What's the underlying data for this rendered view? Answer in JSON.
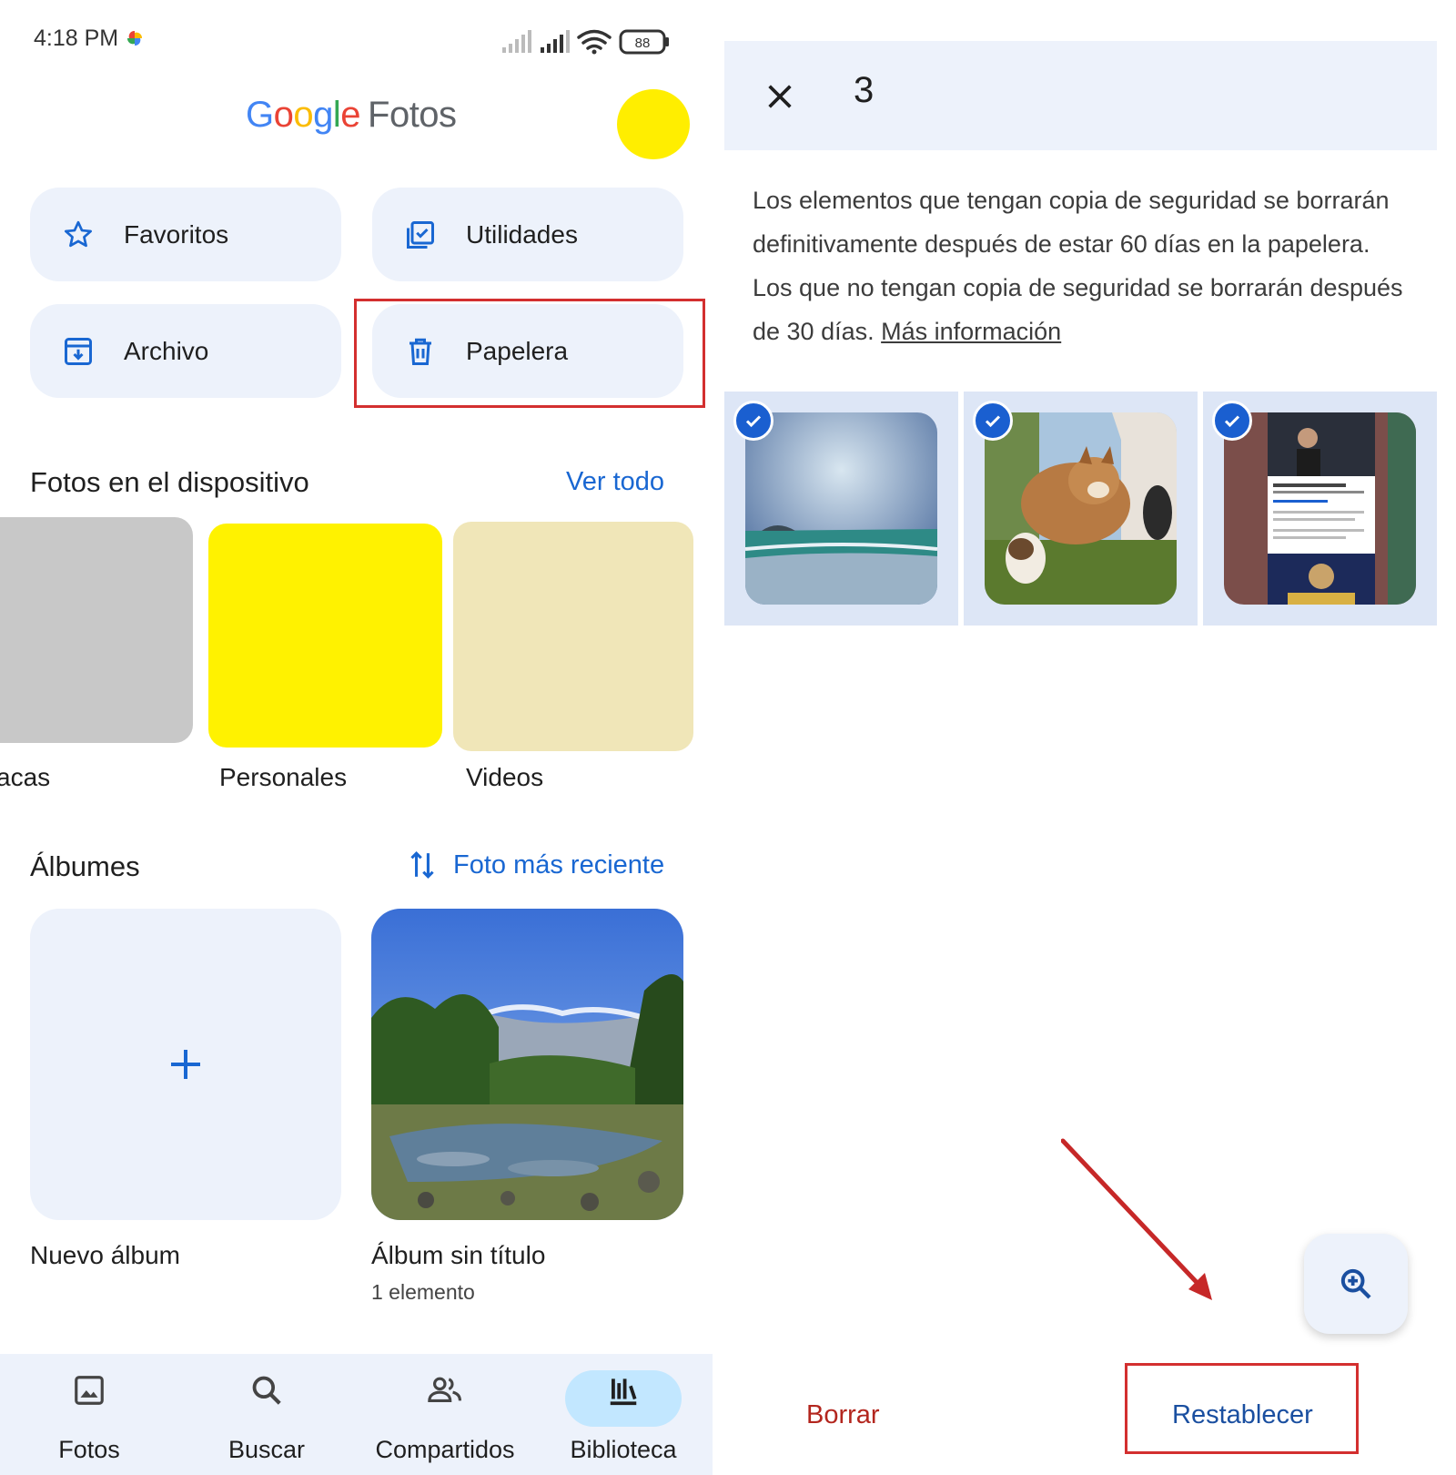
{
  "status_bar": {
    "time": "4:18 PM",
    "battery": "88"
  },
  "app": {
    "logo_word": "Google",
    "logo_product": "Fotos"
  },
  "shortcuts": [
    {
      "label": "Favoritos",
      "icon": "star-icon"
    },
    {
      "label": "Utilidades",
      "icon": "checklist-icon"
    },
    {
      "label": "Archivo",
      "icon": "archive-icon"
    },
    {
      "label": "Papelera",
      "icon": "trash-icon"
    }
  ],
  "device_photos": {
    "title": "Fotos en el dispositivo",
    "see_all": "Ver todo",
    "folders": [
      {
        "label": "acas",
        "color": "#c8c8c8"
      },
      {
        "label": "Personales",
        "color": "#fff200"
      },
      {
        "label": "Videos",
        "color": "#f0e6b8"
      }
    ]
  },
  "albums": {
    "title": "Álbumes",
    "sort_label": "Foto más reciente",
    "new_album_label": "Nuevo álbum",
    "items": [
      {
        "title": "Álbum sin título",
        "count": "1 elemento"
      }
    ]
  },
  "bottom_nav": [
    {
      "label": "Fotos",
      "icon": "photo-icon",
      "active": false
    },
    {
      "label": "Buscar",
      "icon": "search-icon",
      "active": false
    },
    {
      "label": "Compartidos",
      "icon": "people-icon",
      "active": false
    },
    {
      "label": "Biblioteca",
      "icon": "library-icon",
      "active": true
    }
  ],
  "trash": {
    "selected_count": "3",
    "info_text": "Los elementos que tengan copia de seguridad se borrarán definitivamente después de estar 60 días en la papelera. Los que no tengan copia de seguridad se borrarán después de 30 días.",
    "info_link": "Más información",
    "items": [
      {
        "subject": "beach-photo",
        "selected": true
      },
      {
        "subject": "dogs-photo",
        "selected": true
      },
      {
        "subject": "video-screenshot",
        "selected": true
      }
    ],
    "delete_label": "Borrar",
    "restore_label": "Restablecer"
  },
  "colors": {
    "accent_blue": "#1967d2",
    "chip_bg": "#edf2fb",
    "highlight_red": "#d32f2f",
    "delete_red": "#b3261e",
    "nav_active_pill": "#c2e7ff"
  }
}
